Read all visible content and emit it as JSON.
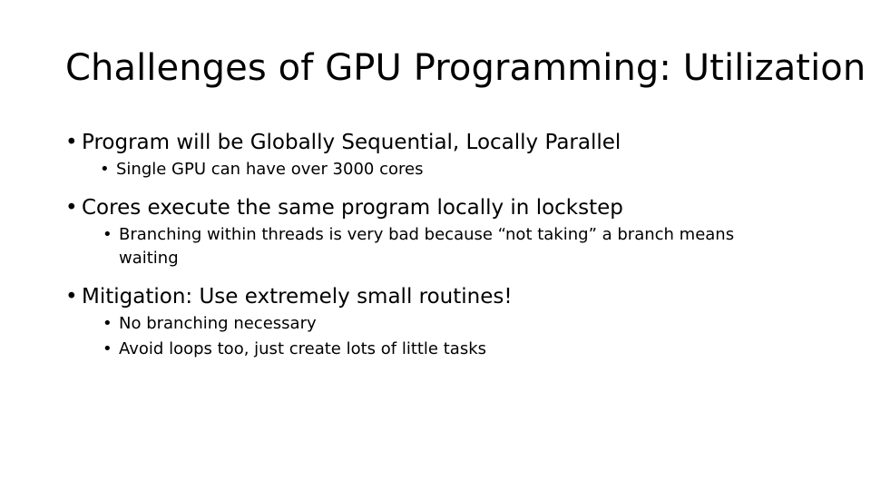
{
  "slide": {
    "background_color": "#ffffff",
    "text_color": "#000000",
    "title": "Challenges of GPU Programming: Utilization",
    "bullet_glyph": "•",
    "groups": [
      {
        "level1": "Program will be Globally Sequential, Locally Parallel",
        "level2": [
          "Single GPU can have over 3000 cores"
        ]
      },
      {
        "level1": "Cores execute the same program locally in lockstep",
        "level2": [
          "Branching within threads is very bad because “not taking” a branch means waiting"
        ]
      },
      {
        "level1": "Mitigation: Use extremely small routines!",
        "level2": [
          "No branching necessary",
          "Avoid loops too, just create lots of little tasks"
        ]
      }
    ]
  }
}
